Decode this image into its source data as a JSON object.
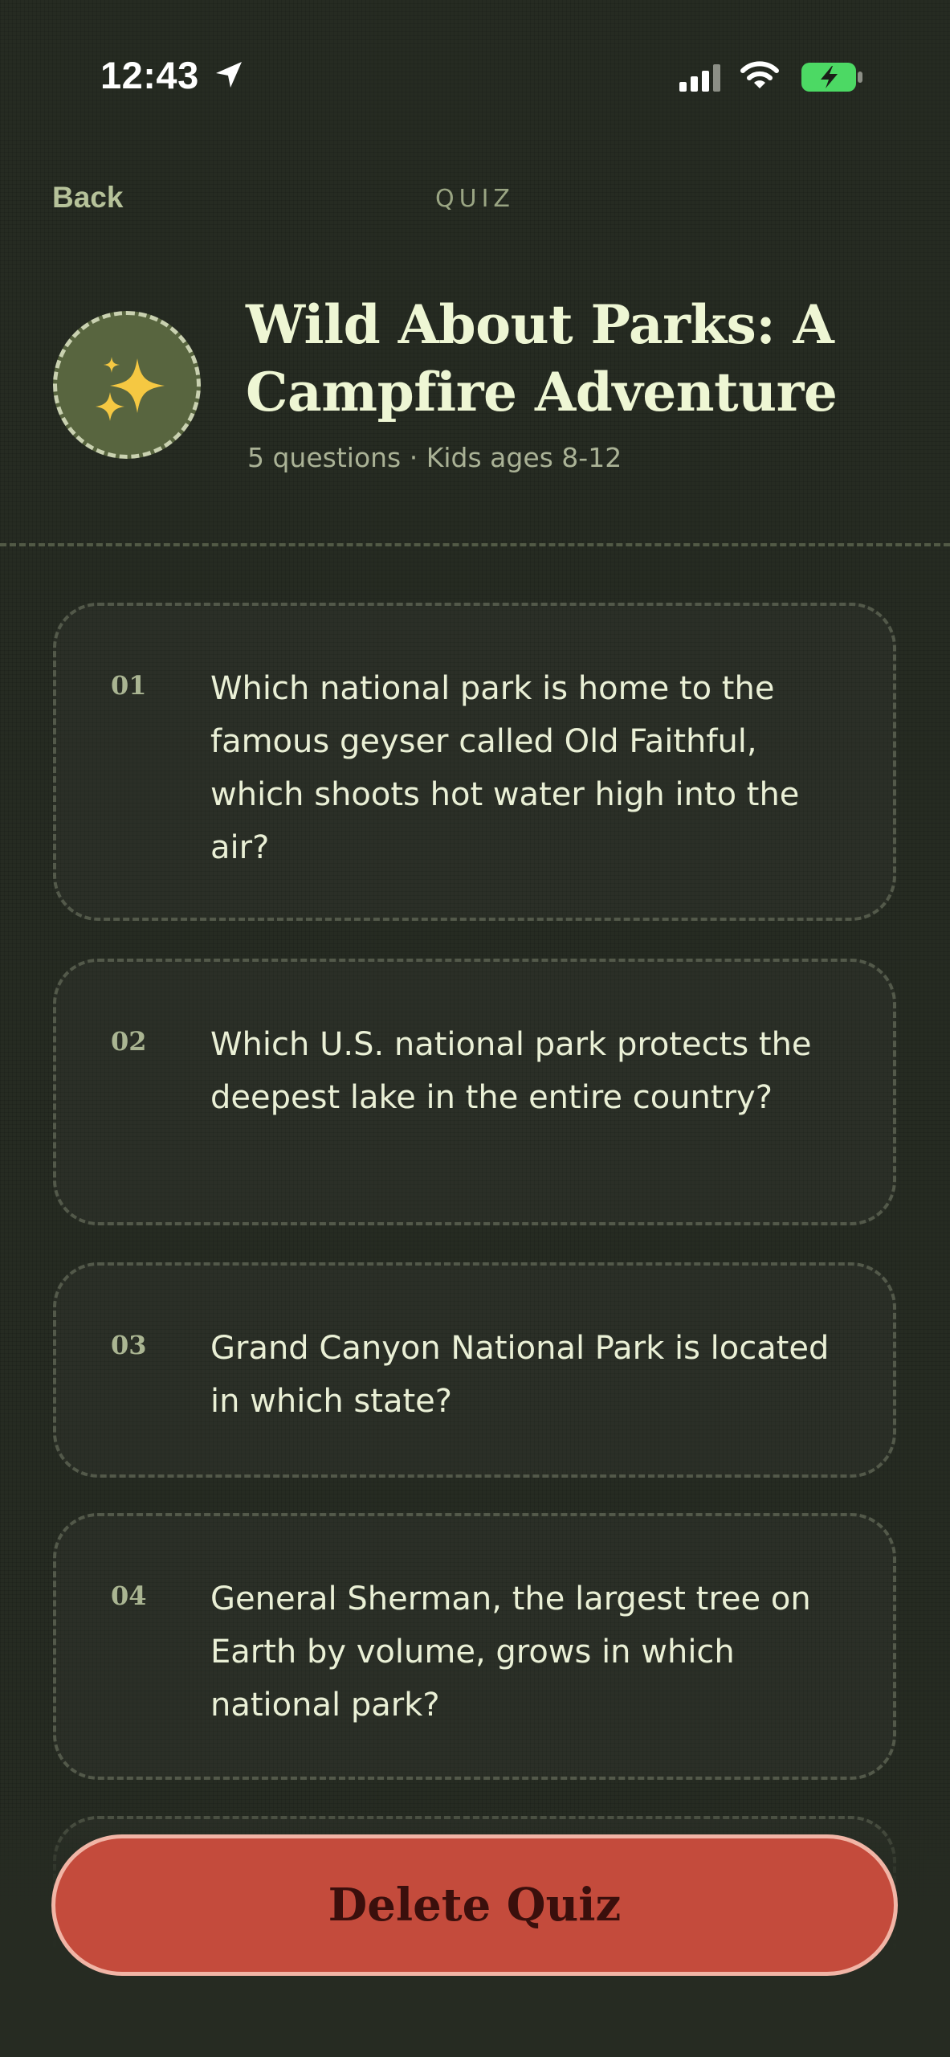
{
  "status_bar": {
    "time": "12:43"
  },
  "nav": {
    "back_label": "Back",
    "title": "QUIZ"
  },
  "quiz": {
    "title": "Wild About Parks: A Campfire Adventure",
    "meta": "5 questions · Kids ages 8-12",
    "badge_icon": "sparkles-icon"
  },
  "questions": [
    {
      "number": "01",
      "text": "Which national park is home to the famous geyser called Old Faithful, which shoots hot water high into the air?"
    },
    {
      "number": "02",
      "text": "Which U.S. national park protects the deepest lake in the entire country?"
    },
    {
      "number": "03",
      "text": "Grand Canyon National Park is located in which state?"
    },
    {
      "number": "04",
      "text": "General Sherman, the largest tree on Earth by volume, grows in which national park?"
    }
  ],
  "actions": {
    "delete_label": "Delete Quiz"
  },
  "colors": {
    "background": "#262b22",
    "accent_green": "#b6c29a",
    "delete_red": "#c44b3c",
    "battery_green": "#4cd964"
  }
}
